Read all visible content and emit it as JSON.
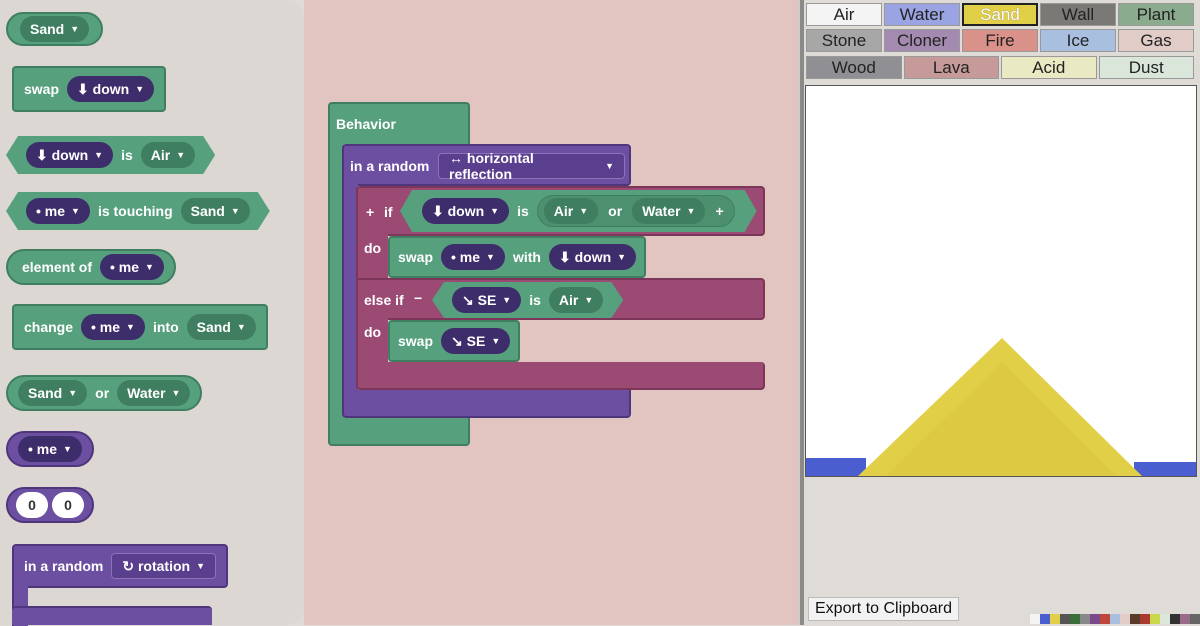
{
  "flyout": {
    "sand_dropdown": "Sand",
    "swap_label": "swap",
    "swap_dir": "⬇ down",
    "is_block": {
      "dir": "⬇ down",
      "is": "is",
      "elem": "Air"
    },
    "touching_block": {
      "who": "• me",
      "label": "is touching",
      "elem": "Sand"
    },
    "element_of": {
      "label": "element of",
      "who": "• me"
    },
    "change_block": {
      "change": "change",
      "who": "• me",
      "into": "into",
      "elem": "Sand"
    },
    "or_block": {
      "a": "Sand",
      "or": "or",
      "b": "Water"
    },
    "me_block": "• me",
    "coord_block": {
      "x": "0",
      "y": "0"
    },
    "random_block": {
      "label": "in a random",
      "mode": "↻ rotation"
    }
  },
  "workspace": {
    "behavior": "Behavior",
    "random_label": "in a random",
    "random_mode": "↔ horizontal reflection",
    "if_plus": "+",
    "if_label": "if",
    "if_dir": "⬇ down",
    "if_is": "is",
    "if_air": "Air",
    "if_or": "or",
    "if_water": "Water",
    "if_add": "+",
    "do1": "do",
    "swap1": "swap",
    "swap1_who": "• me",
    "swap1_with": "with",
    "swap1_dir": "⬇ down",
    "elseif_label": "else if",
    "elseif_minus": "−",
    "elseif_dir": "↘ SE",
    "elseif_is": "is",
    "elseif_air": "Air",
    "do2": "do",
    "swap2": "swap",
    "swap2_dir": "↘ SE"
  },
  "elements": [
    {
      "name": "Air",
      "color": "#f4f4f4",
      "selected": false
    },
    {
      "name": "Water",
      "color": "#9aa4e2",
      "selected": false
    },
    {
      "name": "Sand",
      "color": "#e2cf48",
      "selected": true
    },
    {
      "name": "Wall",
      "color": "#7b7976",
      "selected": false
    },
    {
      "name": "Plant",
      "color": "#8aab8d",
      "selected": false
    },
    {
      "name": "Stone",
      "color": "#a7a7a7",
      "selected": false
    },
    {
      "name": "Cloner",
      "color": "#a48ab0",
      "selected": false
    },
    {
      "name": "Fire",
      "color": "#d9918a",
      "selected": false
    },
    {
      "name": "Ice",
      "color": "#a8bfe0",
      "selected": false
    },
    {
      "name": "Gas",
      "color": "#e1ccc8",
      "selected": false
    },
    {
      "name": "Wood",
      "color": "#8f8f94",
      "selected": false
    },
    {
      "name": "Lava",
      "color": "#c59a98",
      "selected": false
    },
    {
      "name": "Acid",
      "color": "#e9e9c3",
      "selected": false
    },
    {
      "name": "Dust",
      "color": "#d9e6d9",
      "selected": false
    }
  ],
  "export_label": "Export to Clipboard",
  "colors": {
    "sand": "#e2cf48",
    "water": "#4a5ed0"
  }
}
